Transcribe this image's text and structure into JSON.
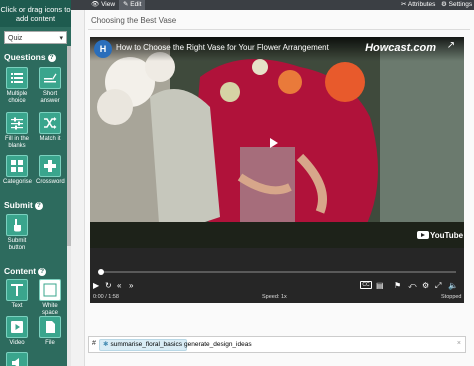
{
  "sidebar": {
    "header": "Click or drag icons to add content",
    "select_value": "Quiz",
    "sections": {
      "questions": "Questions",
      "submit": "Submit",
      "content": "Content"
    },
    "tools": {
      "multiple_choice": "Multiple choice",
      "short_answer": "Short answer",
      "fill_blanks": "Fill in the blanks",
      "match_it": "Match it",
      "categorise": "Categorise",
      "crossword": "Crossword",
      "submit_button": "Submit button",
      "text": "Text",
      "white_space": "White space",
      "video": "Video",
      "file": "File"
    }
  },
  "topbar": {
    "view_tab": "View",
    "edit_tab": "Edit",
    "attributes": "Attributes",
    "settings": "Settings"
  },
  "editor": {
    "title": "Choosing the Best Vase"
  },
  "video": {
    "title": "How to Choose the Right Vase for Your Flower Arrangement",
    "channel_logo_text": "Howcast.com",
    "youtube_brand": "YouTube",
    "time": "0:00 / 1:58",
    "speed": "Speed: 1x",
    "status": "Stopped",
    "cc_label": "CC",
    "progress_fraction": 0.0
  },
  "tags": {
    "hash": "#",
    "chip": "summarise_floral_basics",
    "text": "generate_design_ideas",
    "close": "×"
  },
  "colors": {
    "sidebar": "#2d6b5e",
    "tile": "#3aa58d",
    "topbar": "#3b3f44"
  }
}
